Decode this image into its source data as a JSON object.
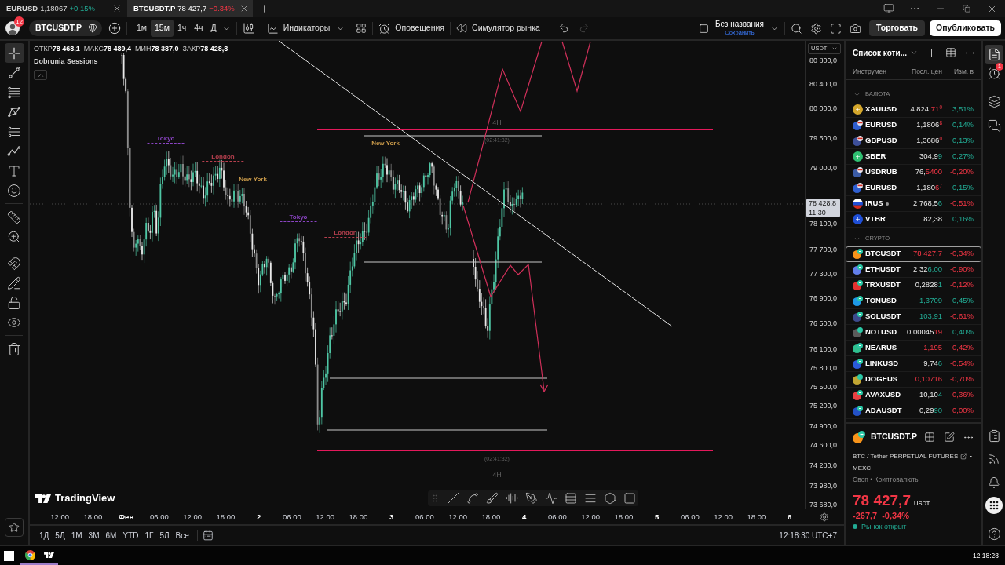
{
  "tabs": [
    {
      "symbol": "EURUSD",
      "price": "1,18067",
      "change": "+0.15%",
      "rising": true,
      "selected": false
    },
    {
      "symbol": "BTCUSDT.P",
      "price": "78 427,7",
      "change": "−0.34%",
      "rising": false,
      "selected": true
    }
  ],
  "header": {
    "avatar_badge": "12",
    "symbol": "BTCUSDT.P",
    "intervals": [
      {
        "label": "1м",
        "selected": false
      },
      {
        "label": "15м",
        "selected": true
      },
      {
        "label": "1ч",
        "selected": false
      },
      {
        "label": "4ч",
        "selected": false
      },
      {
        "label": "Д",
        "selected": false
      }
    ],
    "indicators": "Индикаторы",
    "alerts": "Оповещения",
    "replay": "Симулятор рынка",
    "undo_disabled": false,
    "redo_disabled": true,
    "layout_name": "Без названия",
    "layout_status": "Сохранить",
    "trade": "Торговать",
    "publish": "Опубликовать"
  },
  "left_toolbar": {
    "tools": [
      {
        "kind": "crosshair",
        "selected": true
      },
      {
        "kind": "trend-line",
        "selected": false
      },
      {
        "kind": "horizontal-lines",
        "selected": false
      },
      {
        "kind": "pattern",
        "selected": false
      },
      {
        "kind": "parallel-lines",
        "selected": false
      },
      {
        "kind": "zigzag",
        "selected": false
      },
      {
        "kind": "text",
        "selected": false
      },
      {
        "kind": "emoji",
        "selected": false
      },
      {
        "kind": "ruler",
        "selected": false
      },
      {
        "kind": "zoom-in",
        "selected": false
      },
      {
        "kind": "magnet",
        "selected": false
      },
      {
        "kind": "pencil",
        "selected": false
      },
      {
        "kind": "lock",
        "selected": false
      },
      {
        "kind": "eye",
        "selected": false
      },
      {
        "kind": "trash",
        "selected": false
      }
    ]
  },
  "legend": {
    "fields": [
      {
        "label": "ОТКР",
        "value": "78 468,1"
      },
      {
        "label": "МАКС",
        "value": "78 489,4"
      },
      {
        "label": "МИН",
        "value": "78 387,0"
      },
      {
        "label": "ЗАКР",
        "value": "78 428,8"
      }
    ],
    "indicator": "Dobrunia Sessions"
  },
  "chart": {
    "session_labels": [
      {
        "text": "Tokyo",
        "color": "#8a44c2"
      },
      {
        "text": "London",
        "color": "#b8404f"
      },
      {
        "text": "New York",
        "color": "#c99a4a"
      },
      {
        "text": "Tokyo",
        "color": "#8a44c2"
      },
      {
        "text": "London",
        "color": "#b8404f"
      },
      {
        "text": "New York",
        "color": "#c99a4a"
      }
    ],
    "zone_labels": [
      "4H",
      "(02:41:32)",
      "(02:41:32)",
      "4H"
    ],
    "logo": "TradingView"
  },
  "price_axis": {
    "currency": "USDT",
    "labels": [
      "80 800,0",
      "80 400,0",
      "80 000,0",
      "79 500,0",
      "79 000,0",
      "78 100,0",
      "77 700,0",
      "77 300,0",
      "76 900,0",
      "76 500,0",
      "76 100,0",
      "75 800,0",
      "75 500,0",
      "75 200,0",
      "74 900,0",
      "74 600,0",
      "74 280,0",
      "73 980,0",
      "73 680,0"
    ],
    "last_price": "78 428,8",
    "countdown": "11:30"
  },
  "time_axis": {
    "labels": [
      {
        "text": "12:00",
        "kind": "time"
      },
      {
        "text": "18:00",
        "kind": "time"
      },
      {
        "text": "Фев",
        "kind": "date"
      },
      {
        "text": "06:00",
        "kind": "time"
      },
      {
        "text": "12:00",
        "kind": "time"
      },
      {
        "text": "18:00",
        "kind": "time"
      },
      {
        "text": "2",
        "kind": "date"
      },
      {
        "text": "06:00",
        "kind": "time"
      },
      {
        "text": "12:00",
        "kind": "time"
      },
      {
        "text": "18:00",
        "kind": "time"
      },
      {
        "text": "3",
        "kind": "date"
      },
      {
        "text": "06:00",
        "kind": "time"
      },
      {
        "text": "12:00",
        "kind": "time"
      },
      {
        "text": "18:00",
        "kind": "time"
      },
      {
        "text": "4",
        "kind": "date"
      },
      {
        "text": "06:00",
        "kind": "time"
      },
      {
        "text": "12:00",
        "kind": "time"
      },
      {
        "text": "18:00",
        "kind": "time"
      },
      {
        "text": "5",
        "kind": "date"
      },
      {
        "text": "06:00",
        "kind": "time"
      },
      {
        "text": "12:00",
        "kind": "time"
      },
      {
        "text": "18:00",
        "kind": "time"
      },
      {
        "text": "6",
        "kind": "date"
      }
    ]
  },
  "range_bar": {
    "ranges": [
      "1Д",
      "5Д",
      "1М",
      "3М",
      "6М",
      "YTD",
      "1Г",
      "5Л",
      "Все"
    ],
    "clock": "12:18:30 UTC+7"
  },
  "watchlist": {
    "title": "Список коти...",
    "columns": [
      "Инструмен",
      "Посл. цен",
      "Изм. в"
    ],
    "sections": [
      {
        "name": "ВАЛЮТА",
        "expanded": true,
        "items": [
          {
            "symbol": "XAUUSD",
            "kind": "single",
            "color": "#d4a72c",
            "price": "4 824,",
            "price_tick": "71",
            "price_pip": "0",
            "tick_rising": false,
            "change": "3,51%",
            "change_rising": true,
            "dot": false,
            "selected": false
          },
          {
            "symbol": "EURUSD",
            "kind": "pair",
            "color": "#2f5fd0",
            "price": "1,1806",
            "price_pip": "8",
            "tick_rising": false,
            "change": "0,14%",
            "change_rising": true,
            "dot": false,
            "selected": false
          },
          {
            "symbol": "GBPUSD",
            "kind": "pair",
            "color": "#3d4f9a",
            "price": "1,3686",
            "price_pip": "0",
            "tick_rising": false,
            "change": "0,13%",
            "change_rising": true,
            "dot": false,
            "selected": false
          },
          {
            "symbol": "SBER",
            "kind": "single",
            "color": "#2fbf71",
            "price": "304,9",
            "price_tick": "9",
            "tick_rising": true,
            "change": "0,27%",
            "change_rising": true,
            "dot": false,
            "selected": false
          },
          {
            "symbol": "USDRUB",
            "kind": "pair",
            "color": "#3b5ba5",
            "price": "76,",
            "price_tick": "5400",
            "tick_rising": false,
            "change": "-0,20%",
            "change_rising": false,
            "dot": false,
            "selected": false
          },
          {
            "symbol": "EURUSD",
            "kind": "pair",
            "color": "#2f5fd0",
            "price": "1,180",
            "price_tick": "6",
            "price_pip": "7",
            "tick_rising": false,
            "change": "0,15%",
            "change_rising": true,
            "dot": false,
            "selected": false
          },
          {
            "symbol": "IRUS",
            "kind": "flag",
            "price": "2 768,5",
            "price_tick": "6",
            "tick_rising": true,
            "change": "-0,51%",
            "change_rising": false,
            "dot": true,
            "selected": false
          },
          {
            "symbol": "VTBR",
            "kind": "single",
            "color": "#1f4fd6",
            "price": "82,38",
            "change": "0,16%",
            "change_rising": true,
            "dot": false,
            "selected": false
          }
        ]
      },
      {
        "name": "CRYPTO",
        "expanded": true,
        "items": [
          {
            "symbol": "BTCUSDT",
            "kind": "crypto",
            "color": "#f7931a",
            "price_tick": "78 427,7",
            "tick_rising": false,
            "change": "-0,34%",
            "change_rising": false,
            "dot": false,
            "selected": true
          },
          {
            "symbol": "ETHUSDT",
            "kind": "crypto",
            "color": "#627eea",
            "price": "2 32",
            "price_tick": "6,00",
            "tick_rising": true,
            "change": "-0,90%",
            "change_rising": false,
            "dot": false,
            "selected": false
          },
          {
            "symbol": "TRXUSDT",
            "kind": "crypto",
            "color": "#e5312f",
            "price": "0,2828",
            "price_tick": "1",
            "tick_rising": true,
            "change": "-0,12%",
            "change_rising": false,
            "dot": false,
            "selected": false
          },
          {
            "symbol": "TONUSD",
            "kind": "crypto",
            "color": "#1e9ae8",
            "price_tick": "1,3709",
            "tick_rising": true,
            "change": "0,45%",
            "change_rising": true,
            "dot": false,
            "selected": false
          },
          {
            "symbol": "SOLUSDT",
            "kind": "crypto",
            "color": "#3c4a8c",
            "price_tick": "103,91",
            "tick_rising": true,
            "change": "-0,61%",
            "change_rising": false,
            "dot": false,
            "selected": false
          },
          {
            "symbol": "NOTUSD",
            "kind": "crypto",
            "color": "#5a5a5a",
            "price": "0,00045",
            "price_tick": "19",
            "tick_rising": false,
            "change": "0,40%",
            "change_rising": true,
            "dot": false,
            "selected": false
          },
          {
            "symbol": "NEARUS",
            "kind": "crypto",
            "color": "#2fbf8f",
            "price_tick": "1,195",
            "tick_rising": false,
            "change": "-0,42%",
            "change_rising": false,
            "dot": false,
            "selected": false
          },
          {
            "symbol": "LINKUSD",
            "kind": "crypto",
            "color": "#2a5ada",
            "price": "9,74",
            "price_tick": "6",
            "tick_rising": true,
            "change": "-0,54%",
            "change_rising": false,
            "dot": false,
            "selected": false
          },
          {
            "symbol": "DOGEUS",
            "kind": "crypto",
            "color": "#c2a633",
            "price_tick": "0,10716",
            "tick_rising": false,
            "change": "-0,70%",
            "change_rising": false,
            "dot": false,
            "selected": false
          },
          {
            "symbol": "AVAXUSD",
            "kind": "crypto",
            "color": "#e84142",
            "price": "10,10",
            "price_tick": "4",
            "tick_rising": true,
            "change": "-0,36%",
            "change_rising": false,
            "dot": false,
            "selected": false
          },
          {
            "symbol": "ADAUSDT",
            "kind": "crypto",
            "color": "#2452c7",
            "price": "0,29",
            "price_tick": "90",
            "tick_rising": true,
            "change": "0,00%",
            "change_rising": false,
            "dot": false,
            "selected": false
          }
        ]
      }
    ]
  },
  "details": {
    "symbol": "BTCUSDT.P",
    "description": "BTC / Tether PERPETUAL FUTURES",
    "separator": "•",
    "exchange": "MEXC",
    "category": "Своп • Криптовалюты",
    "price": "78 427,7",
    "currency": "USDT",
    "change": "-267,7",
    "change_percent": "-0,34%",
    "rising": false,
    "market_status": "Рынок открыт",
    "market_open": true
  },
  "right_sidebar": {
    "panels": [
      {
        "kind": "watchlist",
        "selected": true
      },
      {
        "kind": "alerts",
        "selected": false,
        "badge": "1"
      },
      {
        "kind": "layers",
        "selected": false
      },
      {
        "kind": "chat",
        "selected": false
      }
    ]
  },
  "taskbar": {
    "clock": "12:18:28"
  }
}
